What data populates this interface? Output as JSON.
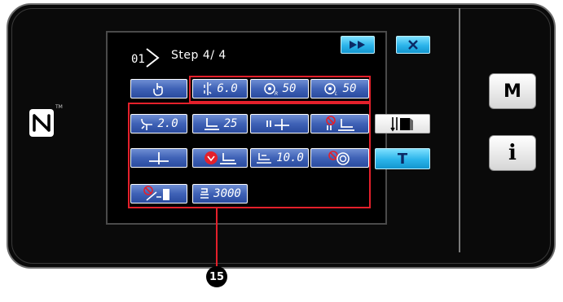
{
  "header": {
    "step_label": "Step  4/ 4",
    "step_icon_text": "01"
  },
  "controls": {
    "fast_forward_icon": "fast-forward-icon",
    "close_icon": "close-icon"
  },
  "rows": {
    "row1": {
      "pitch_value": "6.0",
      "tension_r_value": "50",
      "tension_l_value": "50"
    },
    "row2": {
      "presser_value": "2.0",
      "lift_value": "25"
    },
    "row3": {
      "feed_value": "10.0"
    },
    "row4": {
      "speed_value": "3000"
    }
  },
  "side": {
    "t_label": "T",
    "m_label": "M",
    "i_label": "i"
  },
  "callout": {
    "number": "15"
  },
  "colors": {
    "button_blue": "#3f62b6",
    "button_cyan": "#2bb4ea",
    "highlight_red": "#e4202b"
  }
}
